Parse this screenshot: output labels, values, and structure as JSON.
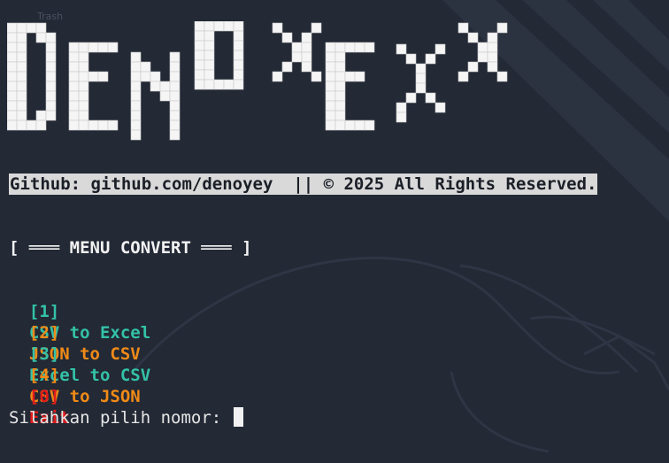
{
  "desktop": {
    "icon_label": "Trash"
  },
  "logo": {
    "text": "DENOYEY"
  },
  "banner": "Github: github.com/denoyey  || © 2025 All Rights Reserved.",
  "menu": {
    "title": "[ ═══ MENU CONVERT ═══ ]",
    "items": [
      {
        "key": "[1]",
        "label": "CSV to Excel",
        "color": "#33c2a7"
      },
      {
        "key": "[2]",
        "label": "JSON to CSV",
        "color": "#f08a17"
      },
      {
        "key": "[3]",
        "label": "Excel to CSV",
        "color": "#33c2a7"
      },
      {
        "key": "[4]",
        "label": "CSV to JSON",
        "color": "#f08a17"
      },
      {
        "key": "[0]",
        "label": "Exit",
        "color": "#e01b1b"
      }
    ]
  },
  "prompt": {
    "text": "Silahkan pilih nomor: "
  },
  "colors": {
    "background": "#232935",
    "logo_fill": "#f5f5f5",
    "banner_bg": "#d9d9d9",
    "teal": "#33c2a7",
    "orange": "#f08a17",
    "red": "#e01b1b"
  }
}
